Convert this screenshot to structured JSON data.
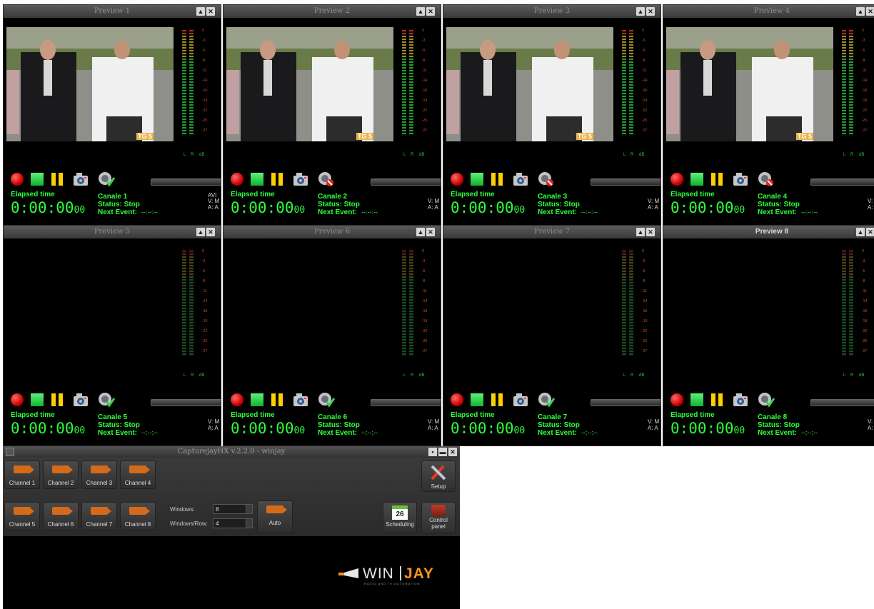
{
  "previews": [
    {
      "title": "Preview 1",
      "channel": "Canale 1",
      "status": "Status: Stop",
      "next_label": "Next Event:",
      "next_value": "--:--:--",
      "elapsed_label": "Elapsed time",
      "time": "0:00:00",
      "frames": "00",
      "vm": "V: M",
      "am": "A: A",
      "avi": "AVI",
      "has_video": true
    },
    {
      "title": "Preview 2",
      "channel": "Canale 2",
      "status": "Status: Stop",
      "next_label": "Next Event:",
      "next_value": "--:--:--",
      "elapsed_label": "Elapsed time",
      "time": "0:00:00",
      "frames": "00",
      "vm": "V: M",
      "am": "A: A",
      "has_video": true
    },
    {
      "title": "Preview 3",
      "channel": "Canale 3",
      "status": "Status: Stop",
      "next_label": "Next Event:",
      "next_value": "--:--:--",
      "elapsed_label": "Elapsed time",
      "time": "0:00:00",
      "frames": "00",
      "vm": "V: M",
      "am": "A: A",
      "has_video": true
    },
    {
      "title": "Preview 4",
      "channel": "Canale 4",
      "status": "Status: Stop",
      "next_label": "Next Event:",
      "next_value": "--:--:--",
      "elapsed_label": "Elapsed time",
      "time": "0:00:00",
      "frames": "00",
      "vm": "V:",
      "am": "A:",
      "has_video": true
    },
    {
      "title": "Preview 5",
      "channel": "Canale 5",
      "status": "Status: Stop",
      "next_label": "Next Event:",
      "next_value": "--:--:--",
      "elapsed_label": "Elapsed time",
      "time": "0:00:00",
      "frames": "00",
      "vm": "V: M",
      "am": "A: A",
      "has_video": false
    },
    {
      "title": "Preview 6",
      "channel": "Canale 6",
      "status": "Status: Stop",
      "next_label": "Next Event:",
      "next_value": "--:--:--",
      "elapsed_label": "Elapsed time",
      "time": "0:00:00",
      "frames": "00",
      "vm": "V: M",
      "am": "A: A",
      "has_video": false
    },
    {
      "title": "Preview 7",
      "channel": "Canale 7",
      "status": "Status: Stop",
      "next_label": "Next Event:",
      "next_value": "--:--:--",
      "elapsed_label": "Elapsed time",
      "time": "0:00:00",
      "frames": "00",
      "vm": "V: M",
      "am": "A: A",
      "has_video": false
    },
    {
      "title": "Preview 8",
      "channel": "Canale 8",
      "status": "Status: Stop",
      "next_label": "Next Event:",
      "next_value": "--:--:--",
      "elapsed_label": "Elapsed time",
      "time": "0:00:00",
      "frames": "00",
      "vm": "V:",
      "am": "A:",
      "has_video": false
    }
  ],
  "vu_scale": [
    "0",
    "-3",
    "-5",
    "-8",
    "-11",
    "-14",
    "-16",
    "-19",
    "-22",
    "-25",
    "-27"
  ],
  "vu_labels": {
    "l": "L",
    "r": "R",
    "db": "dB"
  },
  "overlay_logo": "TG 5",
  "control_panel": {
    "title": "CapturejayHX v.2.2.0 - winjay",
    "channels": [
      "Channel 1",
      "Channel 2",
      "Channel 3",
      "Channel 4",
      "Channel 5",
      "Channel 6",
      "Channel 7",
      "Channel 8"
    ],
    "windows_label": "Windows:",
    "windows_value": "8",
    "windows_row_label": "Windows/Row:",
    "windows_row_value": "4",
    "auto_label": "Auto",
    "setup_label": "Setup",
    "scheduling_label": "Scheduling",
    "scheduling_day": "26",
    "control_panel_label": "Control panel",
    "logo_win": "WIN",
    "logo_jay": "JAY",
    "logo_tagline": "RADIO AND TV AUTOMATION"
  },
  "icons": {
    "record": "record-icon",
    "stop": "stop-icon",
    "pause": "pause-icon",
    "snapshot": "camera-icon",
    "schedule": "schedule-check-icon",
    "close": "close-icon",
    "minimize": "minimize-icon"
  },
  "colors": {
    "accent_green": "#2cff3c",
    "title_bar": "#454545",
    "record_red": "#d00000",
    "pause_yellow": "#ffd000",
    "cam_orange": "#d46a1a",
    "winjay_orange": "#f7941d"
  }
}
